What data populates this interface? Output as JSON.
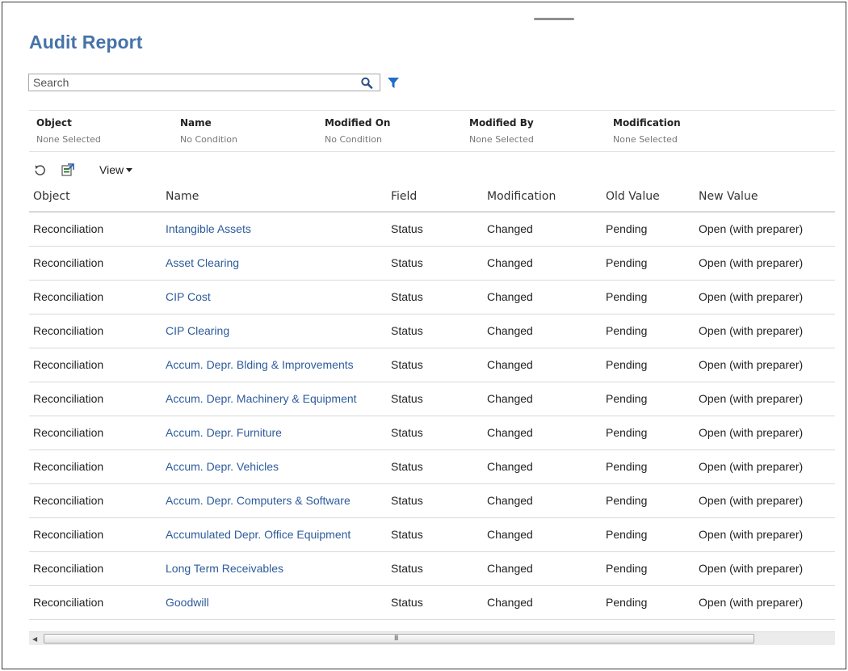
{
  "page": {
    "title": "Audit Report"
  },
  "search": {
    "placeholder": "Search"
  },
  "filters": [
    {
      "label": "Object",
      "value": "None Selected"
    },
    {
      "label": "Name",
      "value": "No Condition"
    },
    {
      "label": "Modified On",
      "value": "No Condition"
    },
    {
      "label": "Modified By",
      "value": "None Selected"
    },
    {
      "label": "Modification",
      "value": "None Selected"
    }
  ],
  "toolbar": {
    "view_label": "View"
  },
  "table": {
    "columns": [
      "Object",
      "Name",
      "Field",
      "Modification",
      "Old Value",
      "New Value"
    ],
    "rows": [
      {
        "object": "Reconciliation",
        "name": "Intangible Assets",
        "field": "Status",
        "modification": "Changed",
        "old_value": "Pending",
        "new_value": "Open (with preparer)"
      },
      {
        "object": "Reconciliation",
        "name": "Asset Clearing",
        "field": "Status",
        "modification": "Changed",
        "old_value": "Pending",
        "new_value": "Open (with preparer)"
      },
      {
        "object": "Reconciliation",
        "name": "CIP Cost",
        "field": "Status",
        "modification": "Changed",
        "old_value": "Pending",
        "new_value": "Open (with preparer)"
      },
      {
        "object": "Reconciliation",
        "name": "CIP Clearing",
        "field": "Status",
        "modification": "Changed",
        "old_value": "Pending",
        "new_value": "Open (with preparer)"
      },
      {
        "object": "Reconciliation",
        "name": "Accum. Depr. Blding & Improvements",
        "field": "Status",
        "modification": "Changed",
        "old_value": "Pending",
        "new_value": "Open (with preparer)"
      },
      {
        "object": "Reconciliation",
        "name": "Accum. Depr. Machinery & Equipment",
        "field": "Status",
        "modification": "Changed",
        "old_value": "Pending",
        "new_value": "Open (with preparer)"
      },
      {
        "object": "Reconciliation",
        "name": "Accum. Depr. Furniture",
        "field": "Status",
        "modification": "Changed",
        "old_value": "Pending",
        "new_value": "Open (with preparer)"
      },
      {
        "object": "Reconciliation",
        "name": "Accum. Depr. Vehicles",
        "field": "Status",
        "modification": "Changed",
        "old_value": "Pending",
        "new_value": "Open (with preparer)"
      },
      {
        "object": "Reconciliation",
        "name": "Accum. Depr. Computers & Software",
        "field": "Status",
        "modification": "Changed",
        "old_value": "Pending",
        "new_value": "Open (with preparer)"
      },
      {
        "object": "Reconciliation",
        "name": "Accumulated Depr. Office Equipment",
        "field": "Status",
        "modification": "Changed",
        "old_value": "Pending",
        "new_value": "Open (with preparer)"
      },
      {
        "object": "Reconciliation",
        "name": "Long Term Receivables",
        "field": "Status",
        "modification": "Changed",
        "old_value": "Pending",
        "new_value": "Open (with preparer)"
      },
      {
        "object": "Reconciliation",
        "name": "Goodwill",
        "field": "Status",
        "modification": "Changed",
        "old_value": "Pending",
        "new_value": "Open (with preparer)"
      }
    ]
  },
  "icons": {
    "search": "search-icon",
    "filter": "filter-icon",
    "refresh": "refresh-icon",
    "export": "export-icon",
    "caret": "chevron-down-icon"
  },
  "colors": {
    "title": "#4673a8",
    "link": "#2d5b9b",
    "filter_icon": "#1f6fc5"
  }
}
